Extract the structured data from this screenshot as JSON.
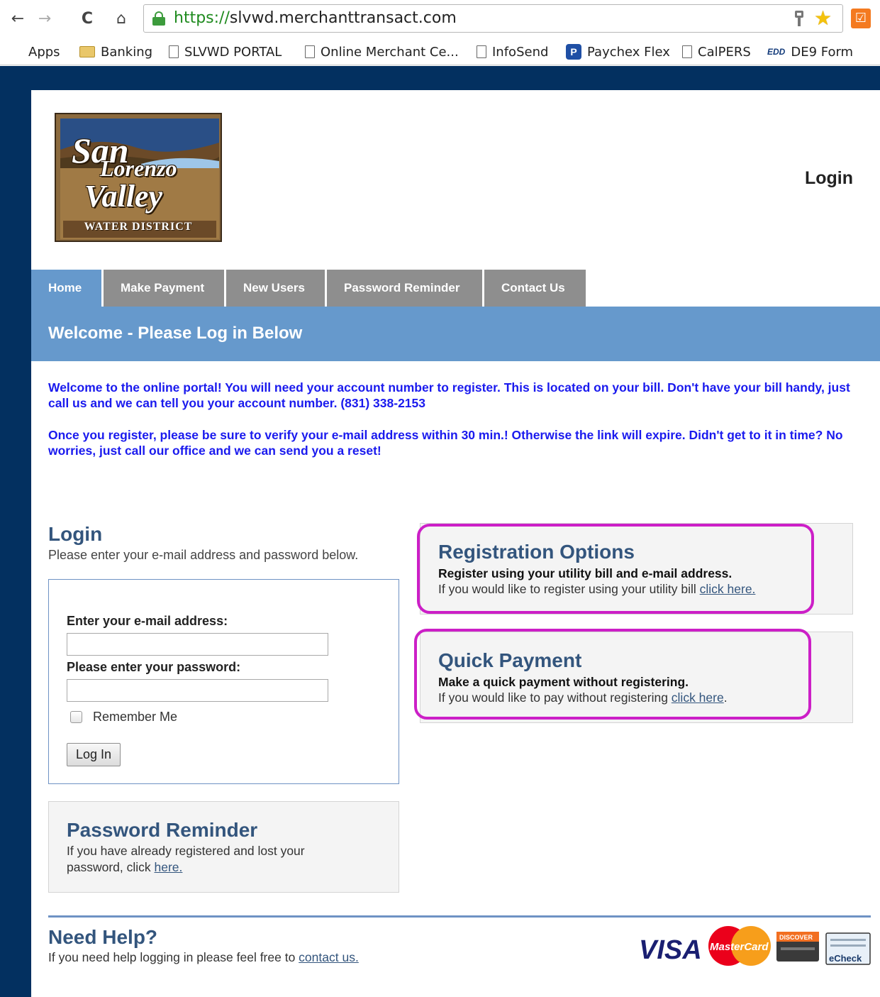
{
  "browser": {
    "url_scheme": "https://",
    "url_host": "slvwd.merchanttransact.com",
    "nav": {
      "back": "←",
      "forward": "→",
      "reload": "C",
      "home": "⌂"
    },
    "bookmarks": [
      {
        "label": "Apps",
        "icon": "apps-grid-icon"
      },
      {
        "label": "Banking",
        "icon": "folder-icon"
      },
      {
        "label": "SLVWD PORTAL",
        "icon": "page-icon"
      },
      {
        "label": "Online Merchant Ce...",
        "icon": "page-icon"
      },
      {
        "label": "InfoSend",
        "icon": "page-icon"
      },
      {
        "label": "Paychex Flex",
        "icon": "paychex-icon"
      },
      {
        "label": "CalPERS",
        "icon": "page-icon"
      },
      {
        "label": "DE9 Form",
        "icon": "edd-icon"
      }
    ],
    "paychex_glyph": "P",
    "edd_glyph": "EDD"
  },
  "logo": {
    "line1": "San",
    "line2": "Lorenzo",
    "line3": "Valley",
    "subtitle": "WATER DISTRICT",
    "colors": {
      "frame": "#8b6a3e",
      "sky": "#2a4f86",
      "hills": "#6b4a28",
      "water": "#9ec6e8"
    }
  },
  "header": {
    "login_label": "Login"
  },
  "tabs": [
    {
      "label": "Home",
      "active": true
    },
    {
      "label": "Make Payment",
      "active": false
    },
    {
      "label": "New Users",
      "active": false
    },
    {
      "label": "Password Reminder",
      "active": false
    },
    {
      "label": "Contact Us",
      "active": false
    }
  ],
  "welcome": {
    "heading": "Welcome - Please Log in Below"
  },
  "intro": {
    "p1": "Welcome to the online portal! You will need your account number to register. This is located on your bill. Don't have your bill handy, just call us and we can tell you your account number.  (831) 338-2153",
    "p2": "Once you register, please be sure to verify your e-mail address within 30 min.! Otherwise the link will expire. Didn't get to it in time? No worries, just call our office and we can send you a reset!"
  },
  "login": {
    "title": "Login",
    "subtitle": "Please enter your e-mail address and password below.",
    "email_label": "Enter your e-mail address:",
    "email_value": "",
    "password_label": "Please enter your password:",
    "password_value": "",
    "remember_label": "Remember Me",
    "remember_checked": false,
    "button_label": "Log In"
  },
  "password_reminder": {
    "title": "Password Reminder",
    "line1": "If you have already registered and lost your",
    "line2_prefix": "password, click ",
    "link": "here."
  },
  "registration": {
    "title": "Registration Options",
    "bold": "Register using your utility bill and e-mail address.",
    "text_prefix": "If you would like to register using your utility bill ",
    "link": "click here."
  },
  "quick_payment": {
    "title": "Quick Payment",
    "bold": "Make a quick payment without registering.",
    "text_prefix": "If you would like to pay without registering ",
    "link": "click here",
    "text_suffix": "."
  },
  "help": {
    "title": "Need Help?",
    "text_prefix": "If you need help logging in please feel free to ",
    "link": "contact us."
  },
  "payment_methods": {
    "visa": "VISA",
    "mastercard": "MasterCard",
    "discover": "DISCOVER",
    "echeck": "eCheck"
  },
  "colors": {
    "frame_navy": "#033060",
    "tab_active": "#6699cc",
    "tab_inactive": "#8e8e8e",
    "heading_blue": "#33557d",
    "intro_text": "#1a1aee",
    "highlight_magenta": "#cc1fc7"
  }
}
